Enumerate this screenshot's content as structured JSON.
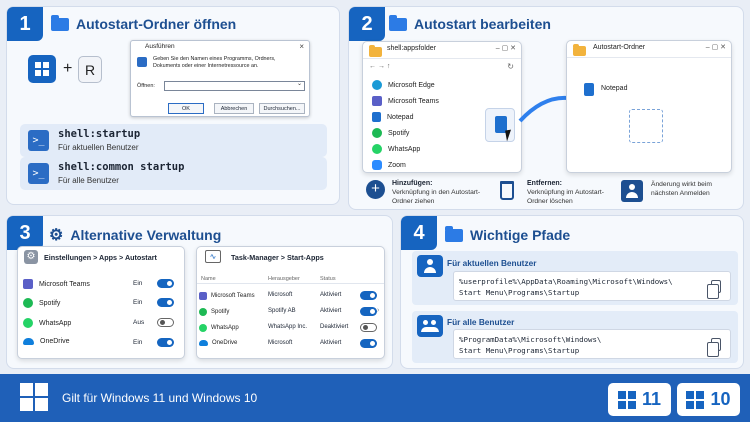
{
  "step1": {
    "num": "1",
    "title": "Autostart-Ordner öffnen",
    "plus": "+",
    "key_r": "R",
    "run_dialog": {
      "title": "Ausführen",
      "text": "Geben Sie den Namen eines Programms, Ordners, Dokuments oder einer Internetressource an.",
      "open_label": "Öffnen:",
      "ok": "OK",
      "cancel": "Abbrechen",
      "browse": "Durchsuchen..."
    },
    "commands": [
      {
        "cmd": "shell:startup",
        "desc": "Für aktuellen Benutzer"
      },
      {
        "cmd": "shell:common startup",
        "desc": "Für alle Benutzer"
      }
    ]
  },
  "step2": {
    "num": "2",
    "title": "Autostart bearbeiten",
    "left_window_title": "shell:appsfolder",
    "apps": [
      "Microsoft Edge",
      "Microsoft Teams",
      "Notepad",
      "Spotify",
      "WhatsApp",
      "Zoom"
    ],
    "right_window_title": "Autostart-Ordner",
    "dropped_app": "Notepad",
    "info": [
      {
        "title": "Hinzufügen:",
        "text": "Verknüpfung in den Autostart-Ordner ziehen"
      },
      {
        "title": "Entfernen:",
        "text": "Verknüpfung im Autostart-Ordner löschen"
      },
      {
        "title": "",
        "text": "Änderung wirkt beim nächsten Anmelden"
      }
    ]
  },
  "step3": {
    "num": "3",
    "title": "Alternative Verwaltung",
    "settings_title": "Einstellungen > Apps > Autostart",
    "settings_apps": [
      {
        "name": "Microsoft Teams",
        "state": "Ein",
        "on": true
      },
      {
        "name": "Spotify",
        "state": "Ein",
        "on": true
      },
      {
        "name": "WhatsApp",
        "state": "Aus",
        "on": false
      },
      {
        "name": "OneDrive",
        "state": "Ein",
        "on": true
      }
    ],
    "taskmgr_title": "Task-Manager > Start-Apps",
    "taskmgr_headers": [
      "Name",
      "Herausgeber",
      "Status"
    ],
    "taskmgr_rows": [
      {
        "name": "Microsoft Teams",
        "publisher": "Microsoft",
        "status": "Aktiviert",
        "on": true
      },
      {
        "name": "Spotify",
        "publisher": "Spotify AB",
        "status": "Aktiviert",
        "on": true
      },
      {
        "name": "WhatsApp",
        "publisher": "WhatsApp Inc.",
        "status": "Deaktiviert",
        "on": false
      },
      {
        "name": "OneDrive",
        "publisher": "Microsoft",
        "status": "Aktiviert",
        "on": true
      }
    ]
  },
  "step4": {
    "num": "4",
    "title": "Wichtige Pfade",
    "paths": [
      {
        "label": "Für aktuellen Benutzer",
        "path": "%userprofile%\\AppData\\Roaming\\Microsoft\\Windows\\\nStart Menu\\Programs\\Startup"
      },
      {
        "label": "Für alle Benutzer",
        "path": "%ProgramData%\\Microsoft\\Windows\\\nStart Menu\\Programs\\Startup"
      }
    ]
  },
  "footer": {
    "text": "Gilt für Windows 11 und Windows 10",
    "badges": [
      "11",
      "10"
    ]
  },
  "colors": {
    "accent": "#1664c0",
    "footer": "#1f60b8",
    "background": "#e9eef6"
  }
}
